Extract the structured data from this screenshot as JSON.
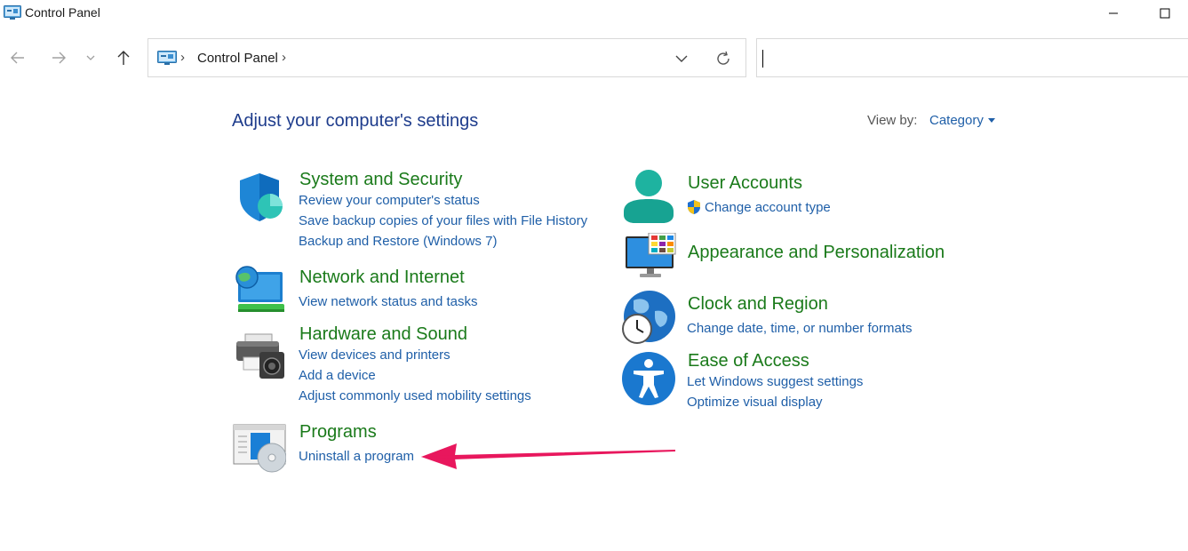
{
  "window": {
    "title": "Control Panel"
  },
  "address": {
    "location": "Control Panel",
    "separator": "›"
  },
  "search": {
    "value": ""
  },
  "main": {
    "heading": "Adjust your computer's settings",
    "view_by_label": "View by:",
    "view_by_value": "Category"
  },
  "categories": {
    "system_security": {
      "title": "System and Security",
      "icon": "shield-icon",
      "links": [
        "Review your computer's status",
        "Save backup copies of your files with File History",
        "Backup and Restore (Windows 7)"
      ]
    },
    "network": {
      "title": "Network and Internet",
      "icon": "network-globe-icon",
      "links": [
        "View network status and tasks"
      ]
    },
    "hardware": {
      "title": "Hardware and Sound",
      "icon": "printer-speaker-icon",
      "links": [
        "View devices and printers",
        "Add a device",
        "Adjust commonly used mobility settings"
      ]
    },
    "programs": {
      "title": "Programs",
      "icon": "programs-disc-icon",
      "links": [
        "Uninstall a program"
      ]
    },
    "user_accounts": {
      "title": "User Accounts",
      "icon": "user-icon",
      "links": [
        "Change account type"
      ]
    },
    "appearance": {
      "title": "Appearance and Personalization",
      "icon": "monitor-palette-icon",
      "links": []
    },
    "clock": {
      "title": "Clock and Region",
      "icon": "clock-globe-icon",
      "links": [
        "Change date, time, or number formats"
      ]
    },
    "ease": {
      "title": "Ease of Access",
      "icon": "accessibility-icon",
      "links": [
        "Let Windows suggest settings",
        "Optimize visual display"
      ]
    }
  },
  "colors": {
    "heading": "#1e3c8c",
    "category_title": "#1a7a1a",
    "link": "#1f5fa8",
    "annotation_arrow": "#e8175d"
  }
}
